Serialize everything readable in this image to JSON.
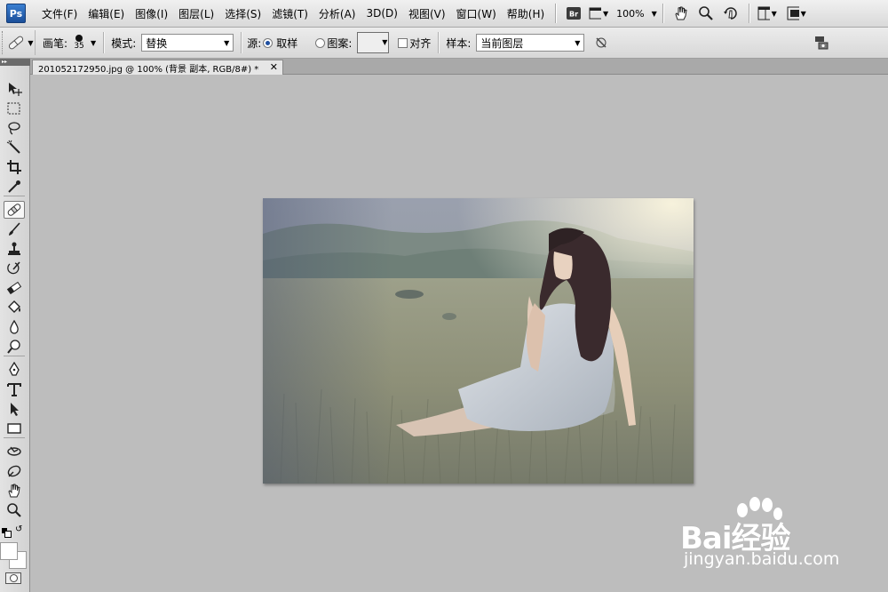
{
  "app": {
    "logo": "Ps",
    "menu": [
      "文件(F)",
      "编辑(E)",
      "图像(I)",
      "图层(L)",
      "选择(S)",
      "滤镜(T)",
      "分析(A)",
      "3D(D)",
      "视图(V)",
      "窗口(W)",
      "帮助(H)"
    ],
    "bridge_label": "Br",
    "zoom": "100%"
  },
  "options": {
    "brush_label": "画笔:",
    "brush_size": "35",
    "mode_label": "模式:",
    "mode_value": "替换",
    "source_label": "源:",
    "source_sampled": "取样",
    "source_pattern": "图案:",
    "aligned_label": "对齐",
    "sample_label": "样本:",
    "sample_value": "当前图层"
  },
  "document": {
    "tab_title": "201052172950.jpg @ 100% (背景 副本, RGB/8#) *"
  },
  "tools": [
    "move-tool",
    "marquee-tool",
    "lasso-tool",
    "magic-wand-tool",
    "crop-tool",
    "eyedropper-tool",
    "healing-brush-tool",
    "brush-tool",
    "clone-stamp-tool",
    "history-brush-tool",
    "eraser-tool",
    "paint-bucket-tool",
    "blur-tool",
    "dodge-tool",
    "pen-tool",
    "type-tool",
    "path-selection-tool",
    "shape-tool",
    "3d-rotate-tool",
    "3d-orbit-tool",
    "hand-tool",
    "zoom-tool"
  ],
  "colors": {
    "foreground": "#ffffff",
    "background": "#ffffff",
    "canvas_bg": "#bdbdbd"
  },
  "watermark": {
    "brand": "Bai经验",
    "url": "jingyan.baidu.com"
  }
}
